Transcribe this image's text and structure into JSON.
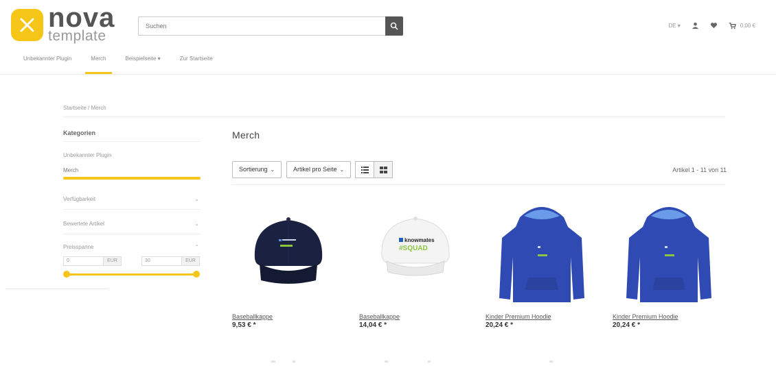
{
  "header": {
    "logo_word": "nova",
    "logo_sub": "template",
    "search_placeholder": "Suchen",
    "lang": "DE",
    "cart_total": "0,00 €"
  },
  "nav": {
    "items": [
      {
        "label": "Unbekannter Plugin"
      },
      {
        "label": "Merch"
      },
      {
        "label": "Beispielseite"
      },
      {
        "label": "Zur Startseite"
      }
    ]
  },
  "breadcrumb": "Startseite / Merch",
  "sidebar": {
    "title": "Kategorien",
    "categories": [
      "Unbekannter Plugin",
      "Merch"
    ],
    "filters": [
      "Verfügbarkeit",
      "Bewertete Artikel",
      "Preisspanne"
    ],
    "price_min": "0",
    "price_max": "30",
    "currency_unit": "EUR"
  },
  "main": {
    "title": "Merch",
    "sort_label": "Sortierung",
    "per_page_label": "Artikel pro Seite",
    "count_text": "Artikel 1 - 11 von 11"
  },
  "products": [
    {
      "name": "Baseballkappe",
      "price": "9,53 € *",
      "image": "navy-baseball-cap",
      "brand": "knowmates",
      "tag": "#SQUAD",
      "color": "#1b2140"
    },
    {
      "name": "Baseballkappe",
      "price": "14,04 € *",
      "image": "white-baseball-cap",
      "brand": "knowmates",
      "tag": "#SQUAD",
      "color": "#f4f4f4"
    },
    {
      "name": "Kinder Premium Hoodie",
      "price": "20,24 € *",
      "image": "blue-hoodie",
      "brand": "knowmates",
      "tag": "#SQUAD",
      "color": "#2f4bb3"
    },
    {
      "name": "Kinder Premium Hoodie",
      "price": "20,24 € *",
      "image": "blue-hoodie",
      "brand": "knowmates",
      "tag": "#SQUAD",
      "color": "#2f4bb3"
    }
  ],
  "colors": {
    "accent": "#f5c518",
    "text": "#333333"
  }
}
